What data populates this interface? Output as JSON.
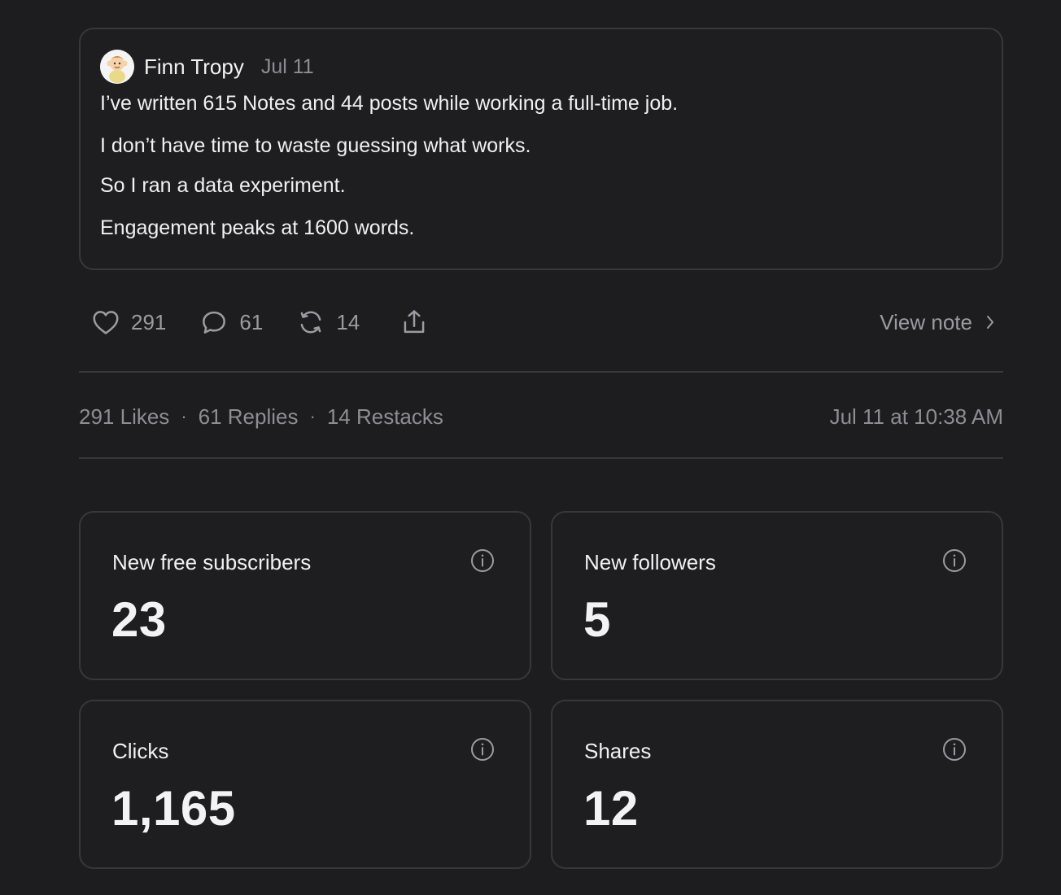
{
  "note": {
    "author": {
      "name": "Finn Tropy",
      "avatar_icon": "cartoon-avatar-icon"
    },
    "date": "Jul 11",
    "lines": [
      "I’ve written 615 Notes and 44 posts while working a full-time job.",
      "I don’t have time to waste guessing what works.",
      "So I ran a data experiment.",
      "Engagement peaks at 1600 words."
    ]
  },
  "actions": {
    "likes": "291",
    "replies": "61",
    "restacks": "14",
    "share_icon": "share-icon",
    "view_note_label": "View note"
  },
  "stats": {
    "likes": "291 Likes",
    "replies": "61 Replies",
    "restacks": "14 Restacks",
    "separator": "·",
    "timestamp": "Jul 11 at 10:38 AM"
  },
  "metrics": [
    {
      "label": "New free subscribers",
      "value": "23"
    },
    {
      "label": "New followers",
      "value": "5"
    },
    {
      "label": "Clicks",
      "value": "1,165"
    },
    {
      "label": "Shares",
      "value": "12"
    }
  ],
  "colors": {
    "background": "#1d1d1f",
    "card_border": "#38383b",
    "muted_text": "#8d8d93",
    "primary_text": "#f1f1f3"
  }
}
